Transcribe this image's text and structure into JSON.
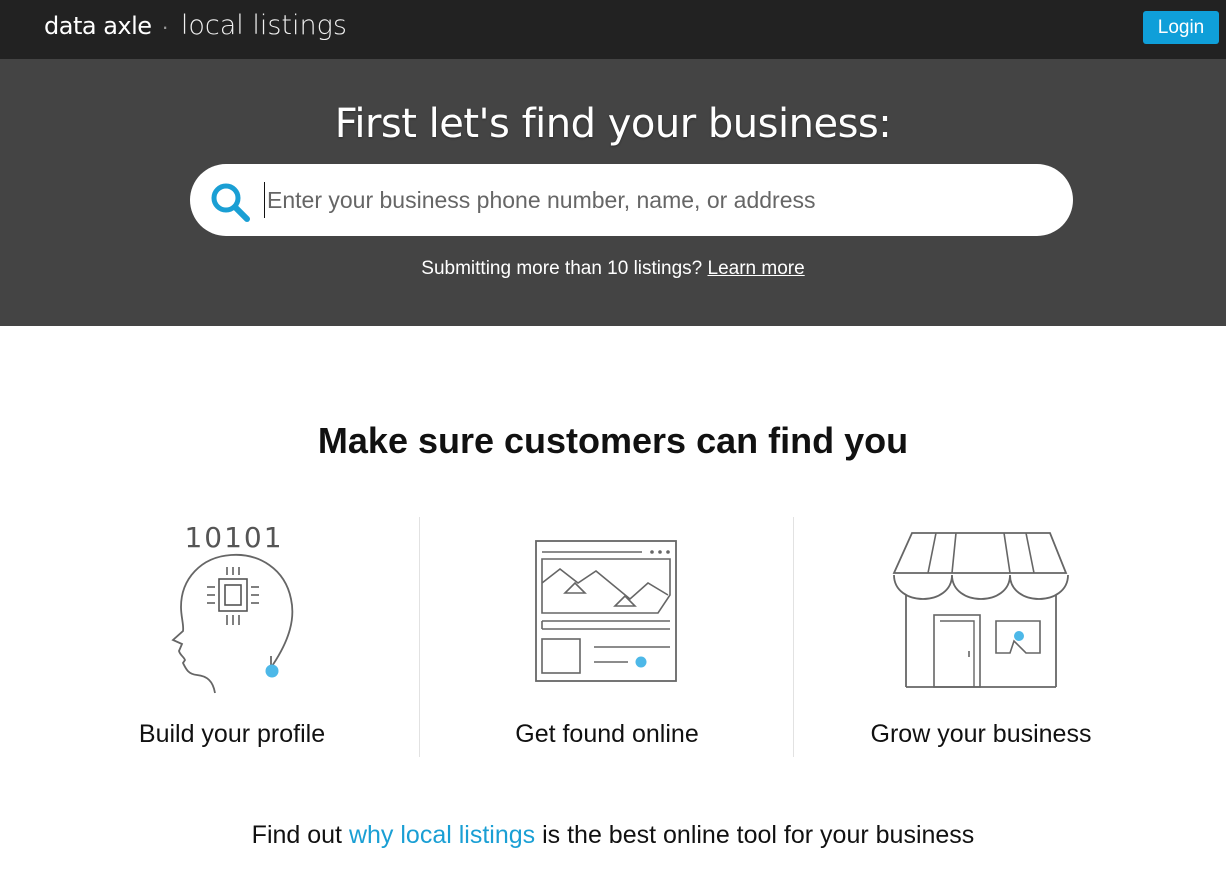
{
  "header": {
    "brand_main": "data axle",
    "brand_separator": "·",
    "brand_sub": "local listings",
    "login_label": "Login"
  },
  "hero": {
    "title": "First let's find your business:",
    "search_placeholder": "Enter your business phone number, name, or address",
    "note_text": "Submitting more than 10 listings?",
    "note_link": "Learn more"
  },
  "main": {
    "title": "Make sure customers can find you",
    "features": [
      {
        "label": "Build your profile",
        "icon": "head-chip-icon",
        "icon_text": "10101"
      },
      {
        "label": "Get found online",
        "icon": "webpage-icon"
      },
      {
        "label": "Grow your business",
        "icon": "storefront-icon"
      }
    ],
    "bottom_prefix": "Find out",
    "bottom_link": "why local listings",
    "bottom_suffix": "is the best online tool for your business"
  },
  "colors": {
    "topbar": "#222222",
    "hero": "#444444",
    "accent": "#0f9fd9",
    "icon_dot": "#4db8e8",
    "link": "#1a9fd4"
  }
}
